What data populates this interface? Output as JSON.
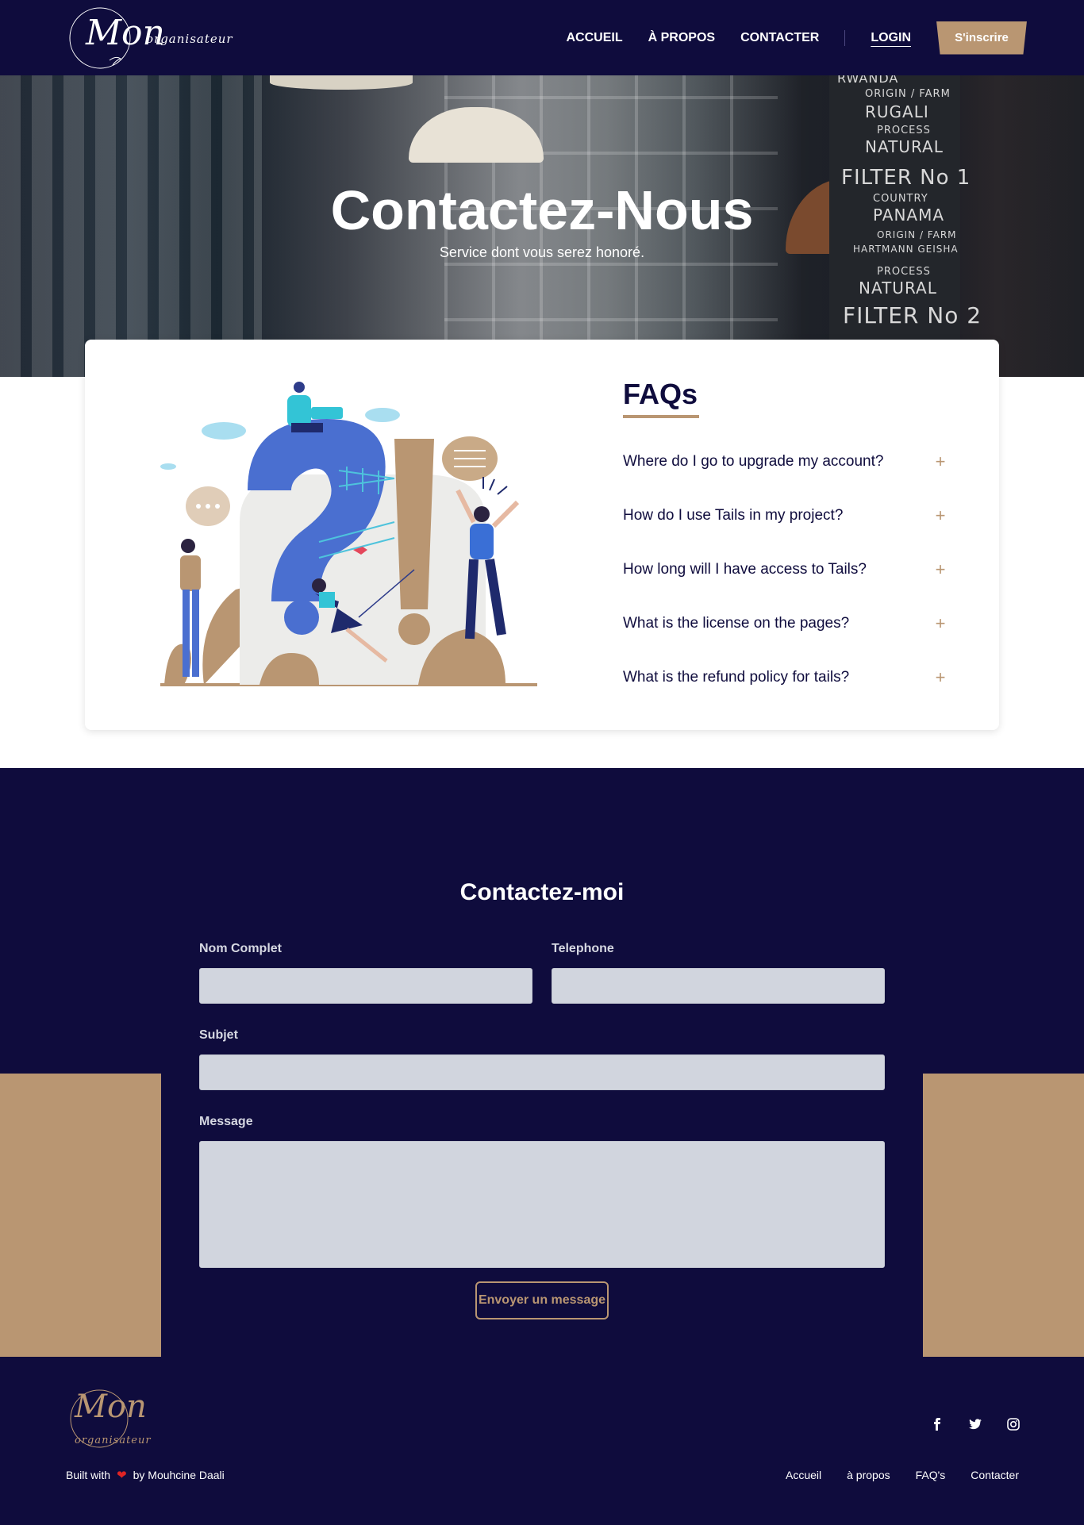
{
  "nav": {
    "logo_big": "Mon",
    "logo_small": "organisateur",
    "links": [
      "ACCUEIL",
      "À PROPOS",
      "CONTACTER"
    ],
    "login": "LOGIN",
    "signup": "S'inscrire"
  },
  "hero": {
    "title": "Contactez-Nous",
    "subtitle": "Service dont vous serez honoré.",
    "board_lines": [
      "RWANDA",
      "ORIGIN / FARM",
      "RUGALI",
      "PROCESS",
      "NATURAL",
      "FILTER No 1",
      "COUNTRY",
      "PANAMA",
      "ORIGIN / FARM",
      "HARTMANN GEISHA",
      "PROCESS",
      "NATURAL",
      "FILTER No 2"
    ]
  },
  "faq": {
    "title": "FAQs",
    "questions": [
      "Where do I go to upgrade my account?",
      "How do I use Tails in my project?",
      "How long will I have access to Tails?",
      "What is the license on the pages?",
      "What is the refund policy for tails?"
    ],
    "toggle_symbol": "+"
  },
  "contact": {
    "title": "Contactez-moi",
    "labels": {
      "name": "Nom Complet",
      "phone": "Telephone",
      "subject": "Subjet",
      "message": "Message"
    },
    "values": {
      "name": "",
      "phone": "",
      "subject": "",
      "message": ""
    },
    "submit": "Envoyer un message"
  },
  "footer": {
    "logo_big": "Mon",
    "logo_small": "organisateur",
    "built_prefix": "Built with",
    "built_suffix": "by Mouhcine Daali",
    "social_icons": [
      "facebook-icon",
      "twitter-icon",
      "instagram-icon"
    ],
    "links": [
      "Accueil",
      "à propos",
      "FAQ's",
      "Contacter"
    ]
  },
  "colors": {
    "navy": "#0f0c3d",
    "tan": "#b99672",
    "input_bg": "#d1d5de",
    "white": "#ffffff"
  }
}
